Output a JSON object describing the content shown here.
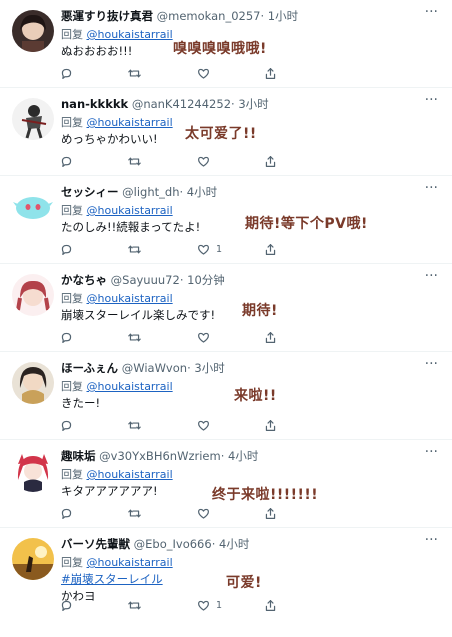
{
  "tweets": [
    {
      "name": "悪運すり抜け真君",
      "handle": "@memokan_0257",
      "time": "· 1小时",
      "reply_prefix": "回复",
      "reply_to": "@houkaistarrail",
      "text": "ぬおおおお!!!",
      "annotation": "嗅嗅嗅嗅哦哦!",
      "like_count": ""
    },
    {
      "name": "nan-kkkkk",
      "handle": "@nanK41244252",
      "time": "· 3小时",
      "reply_prefix": "回复",
      "reply_to": "@houkaistarrail",
      "text": "めっちゃかわいい!",
      "annotation": "太可爱了!!",
      "like_count": ""
    },
    {
      "name": "セッシィー",
      "handle": "@light_dh",
      "time": "· 4小时",
      "reply_prefix": "回复",
      "reply_to": "@houkaistarrail",
      "text": "たのしみ!!続報まってたよ!",
      "annotation": "期待!等下个PV哦!",
      "like_count": "1"
    },
    {
      "name": "かなちゃ",
      "handle": "@Sayuuu72",
      "time": "· 10分钟",
      "reply_prefix": "回复",
      "reply_to": "@houkaistarrail",
      "text": "崩壊スターレイル楽しみです!",
      "annotation": "期待!",
      "like_count": ""
    },
    {
      "name": "ほーふぇん",
      "handle": "@WiaWvon",
      "time": "· 3小时",
      "reply_prefix": "回复",
      "reply_to": "@houkaistarrail",
      "text": "きたー!",
      "annotation": "来啦!!",
      "like_count": ""
    },
    {
      "name": "趣味垢",
      "handle": "@v30YxBH6nWzriem",
      "time": "· 4小时",
      "reply_prefix": "回复",
      "reply_to": "@houkaistarrail",
      "text": "キタアアアアアア!",
      "annotation": "终于来啦!!!!!!!",
      "like_count": ""
    },
    {
      "name": "バーソ先輩獣",
      "handle": "@Ebo_Ivo666",
      "time": "· 4小时",
      "reply_prefix": "回复",
      "reply_to": "@houkaistarrail",
      "hashtag": "#崩壊スターレイル",
      "text": "かわヨ",
      "annotation": "可爱!",
      "like_count": "1"
    }
  ],
  "icons": {
    "more": "more-options-icon",
    "reply": "reply-icon",
    "retweet": "retweet-icon",
    "like": "heart-icon",
    "share": "share-icon"
  },
  "colors": {
    "link": "#1d63c2",
    "annotation": "#7a3a2a",
    "muted": "#536471"
  }
}
